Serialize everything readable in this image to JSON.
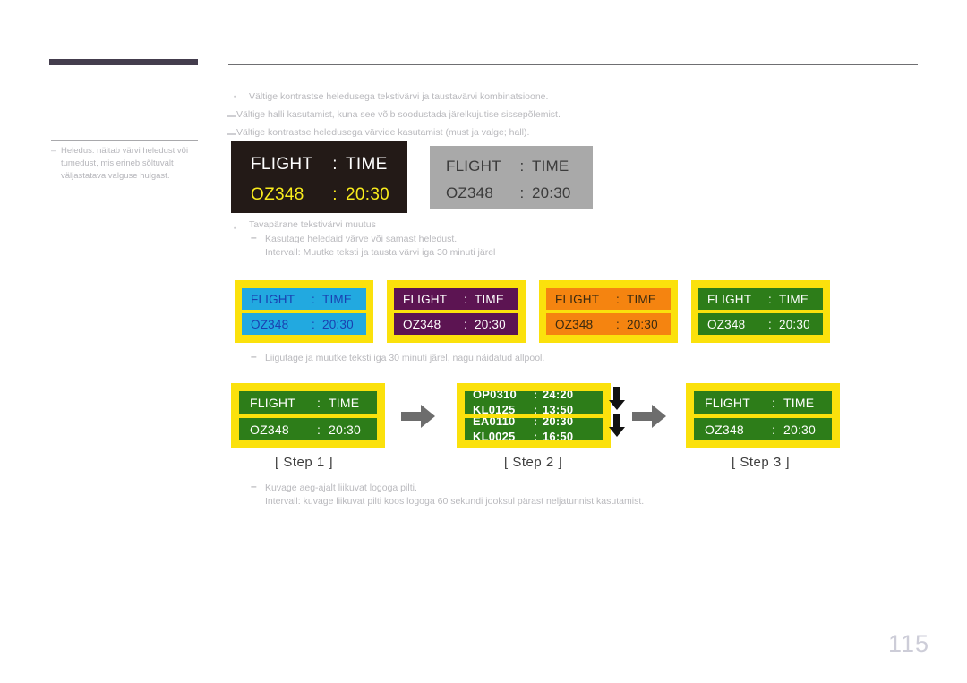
{
  "page": {
    "number": "115"
  },
  "sidebar": {
    "note": {
      "dash": "–",
      "text": "Heledus: näitab värvi heledust või tumedust, mis erineb sõltuvalt väljastatava valguse hulgast."
    }
  },
  "content": {
    "bullet_symbol": "•",
    "dash_symbol": "–",
    "lines": [
      "Vältige kontrastse heledusega tekstivärvi ja taustavärvi kombinatsioone.",
      "Vältige halli kasutamist, kuna see võib soodustada järelkujutise sissepõlemist.",
      "Vältige kontrastse heledusega värvide kasutamist (must ja valge; hall).",
      "Tavapärane tekstivärvi muutus",
      "Kasutage heledaid värve või samast heledust.",
      "Intervall: Muutke teksti ja tausta värvi iga 30 minuti järel",
      "Liigutage ja muutke teksti iga 30 minuti järel, nagu näidatud allpool.",
      "Kuvage aeg-ajalt liikuvat logoga pilti.",
      "Intervall: kuvage liikuvat pilti koos logoga 60 sekundi jooksul pärast neljatunnist kasutamist."
    ]
  },
  "flight_display": {
    "labels": {
      "flight": "FLIGHT",
      "time": "TIME",
      "colon": ":"
    },
    "values": {
      "flight_no": "OZ348",
      "time": "20:30"
    }
  },
  "examples": {
    "contrast": [
      {
        "name": "dark-panel",
        "bg": "#231a17",
        "header_color": "#ffffff",
        "value_color": "#f9ec1c"
      },
      {
        "name": "gray-panel",
        "bg": "#a9a9a9",
        "header_color": "#3b3b3b",
        "value_color": "#3b3b3b"
      }
    ],
    "color_swatches": [
      {
        "name": "cyan-on-yellow",
        "frame": "#fbe10c",
        "bar": "#22a9e0",
        "text": "#1a3fb0"
      },
      {
        "name": "purple-on-yellow",
        "frame": "#fbe10c",
        "bar": "#5c1452",
        "text": "#ffffff"
      },
      {
        "name": "orange-on-yellow",
        "frame": "#fbe10c",
        "bar": "#f58410",
        "text": "#3a2a10"
      },
      {
        "name": "green-on-yellow",
        "frame": "#fbe10c",
        "bar": "#2d7d19",
        "text": "#ffffff"
      }
    ]
  },
  "steps": {
    "captions": [
      "[ Step 1 ]",
      "[ Step 2 ]",
      "[ Step 3 ]"
    ],
    "scrolling_rows": {
      "bar1": [
        {
          "code": "OP0310",
          "colon": ":",
          "time": "24:20"
        },
        {
          "code": "KL0125",
          "colon": ":",
          "time": "13:50"
        }
      ],
      "bar2": [
        {
          "code": "EA0110",
          "colon": ":",
          "time": "20:30"
        },
        {
          "code": "KL0025",
          "colon": ":",
          "time": "16:50"
        }
      ]
    }
  },
  "icons": {
    "arrow_right": "arrow-right-icon",
    "arrow_down": "arrow-down-icon"
  }
}
